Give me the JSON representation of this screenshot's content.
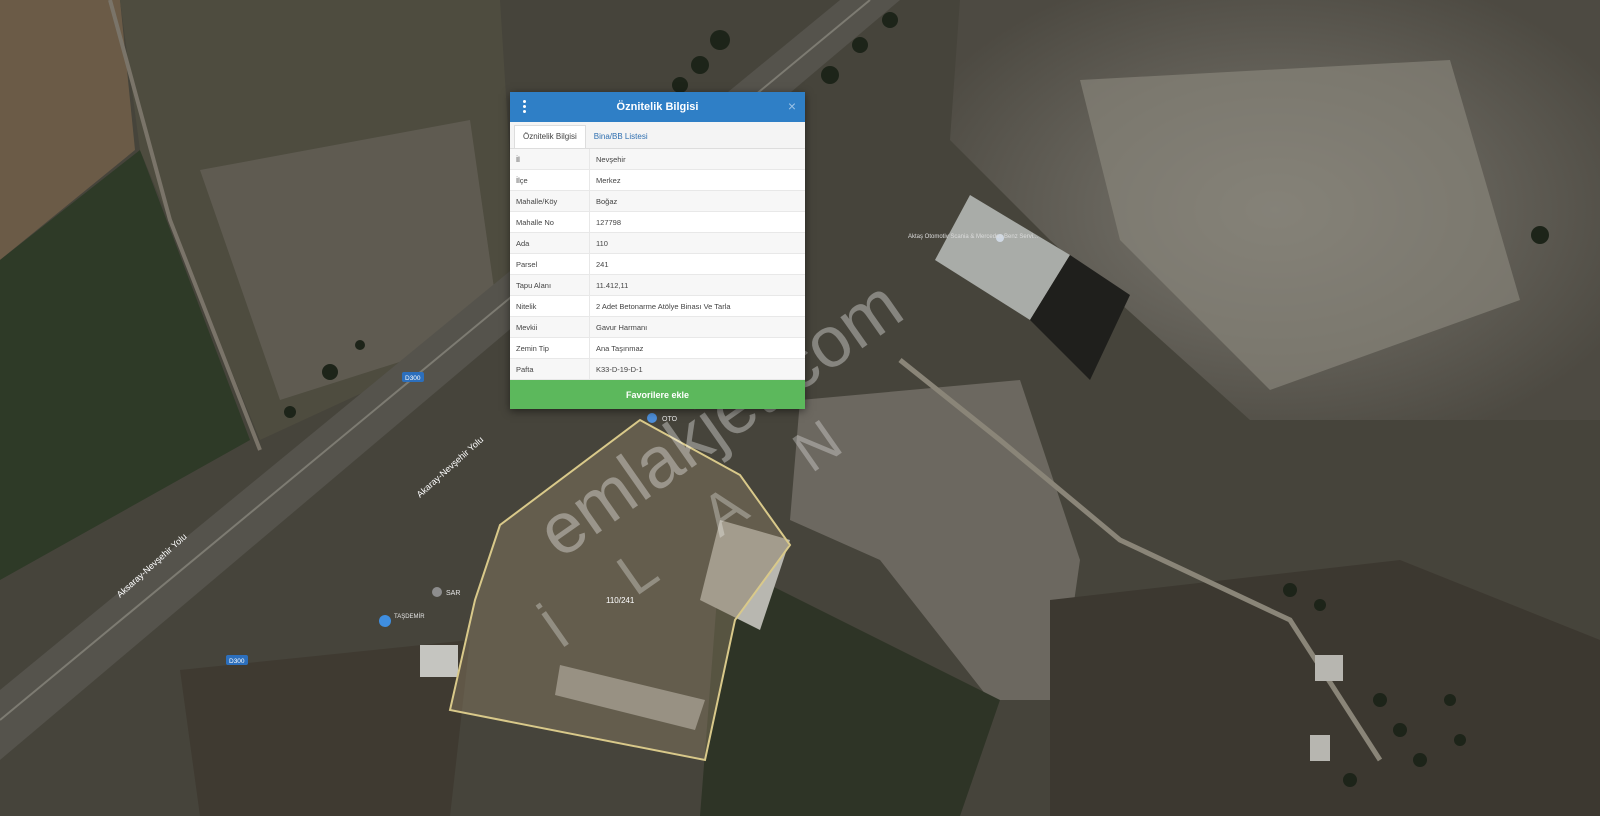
{
  "popup": {
    "title": "Öznitelik Bilgisi",
    "menu_icon": "kebab-menu-icon",
    "close_label": "×",
    "tabs": [
      {
        "label": "Öznitelik Bilgisi",
        "active": true
      },
      {
        "label": "Bina/BB Listesi",
        "active": false
      }
    ],
    "rows": [
      {
        "key": "İl",
        "value": "Nevşehir"
      },
      {
        "key": "İlçe",
        "value": "Merkez"
      },
      {
        "key": "Mahalle/Köy",
        "value": "Boğaz"
      },
      {
        "key": "Mahalle No",
        "value": "127798"
      },
      {
        "key": "Ada",
        "value": "110"
      },
      {
        "key": "Parsel",
        "value": "241"
      },
      {
        "key": "Tapu Alanı",
        "value": "11.412,11"
      },
      {
        "key": "Nitelik",
        "value": "2 Adet Betonarme Atölye Binası Ve Tarla"
      },
      {
        "key": "Mevkii",
        "value": "Gavur Harmanı"
      },
      {
        "key": "Zemin Tip",
        "value": "Ana Taşınmaz"
      },
      {
        "key": "Pafta",
        "value": "K33-D-19-D-1"
      }
    ],
    "favorite_button": "Favorilere ekle"
  },
  "map": {
    "parcel_label": "110/241",
    "road_labels": [
      "Akaray-Nevşehir Yolu",
      "Aksaray-Nevşehir Yolu"
    ],
    "route_shields": [
      "D300",
      "D300"
    ],
    "poi_labels": [
      "Aktaş Otomotiv Scania & Mercedes Benz Servi...",
      "OTO",
      "SAR",
      "TAŞDEMİR"
    ],
    "parcel_outline_color": "#d9c98a",
    "popup_accent": "#2f7fc6",
    "button_color": "#5cb85c"
  },
  "watermark": {
    "text": "emlakjet.com",
    "subtext": "İ L A N"
  }
}
